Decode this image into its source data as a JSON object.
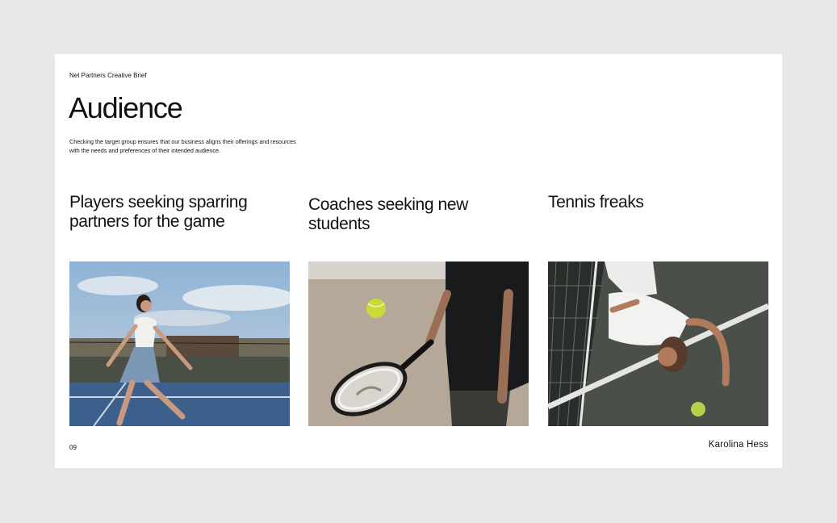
{
  "slide": {
    "brief_label": "Net Partners Creative Brief",
    "title": "Audience",
    "description": "Checking the target group ensures that our business aligns their offerings and resources with the needs and preferences of their intended audience.",
    "page_number": "09",
    "author": "Karolina Hess"
  },
  "columns": [
    {
      "title": "Players seeking sparring partners for the game"
    },
    {
      "title": "Coaches seeking new students"
    },
    {
      "title": "Tennis freaks"
    }
  ],
  "colors": {
    "background": "#e8e8e8",
    "slide": "#ffffff",
    "text": "#111111"
  }
}
